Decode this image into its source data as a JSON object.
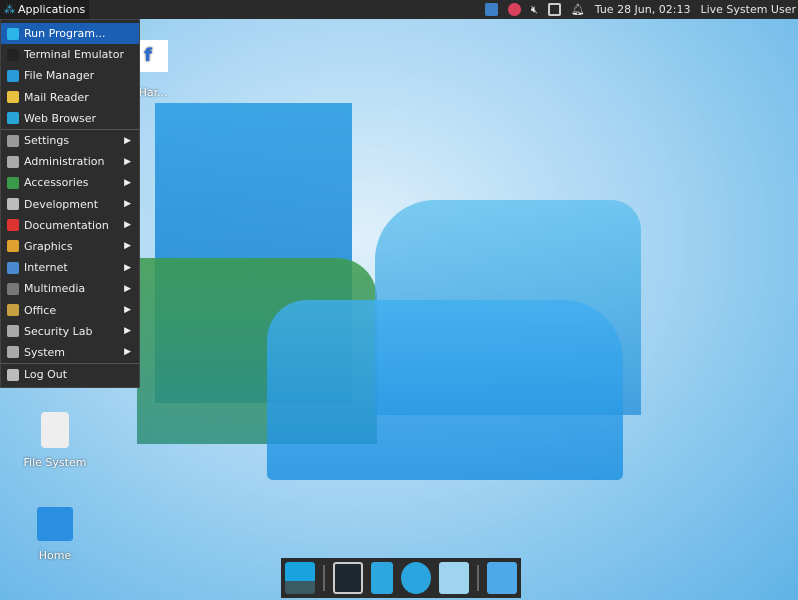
{
  "panel": {
    "applications": "Applications",
    "clock": "Tue 28 Jun, 02:13",
    "user": "Live System User"
  },
  "tray": [
    "network-icon",
    "software-update-icon",
    "volume-muted-icon",
    "clipboard-icon",
    "notifications-icon"
  ],
  "menu": [
    {
      "label": "Run Program...",
      "icon": "run-icon",
      "color": "#2cb5e8",
      "selected": true
    },
    {
      "label": "Terminal Emulator",
      "icon": "terminal-icon",
      "color": "#222"
    },
    {
      "label": "File Manager",
      "icon": "file-manager-icon",
      "color": "#2a9bd8"
    },
    {
      "label": "Mail Reader",
      "icon": "mail-icon",
      "color": "#e8c040"
    },
    {
      "label": "Web Browser",
      "icon": "web-browser-icon",
      "color": "#2aa5d8"
    },
    {
      "label": "Settings",
      "icon": "settings-icon",
      "color": "#999",
      "submenu": true
    },
    {
      "label": "Administration",
      "icon": "administration-icon",
      "color": "#aaa",
      "submenu": true
    },
    {
      "label": "Accessories",
      "icon": "accessories-icon",
      "color": "#3a9a4a",
      "submenu": true
    },
    {
      "label": "Development",
      "icon": "development-icon",
      "color": "#bbb",
      "submenu": true
    },
    {
      "label": "Documentation",
      "icon": "documentation-icon",
      "color": "#d33",
      "submenu": true
    },
    {
      "label": "Graphics",
      "icon": "graphics-icon",
      "color": "#e0a030",
      "submenu": true
    },
    {
      "label": "Internet",
      "icon": "internet-icon",
      "color": "#4a8ad0",
      "submenu": true
    },
    {
      "label": "Multimedia",
      "icon": "multimedia-icon",
      "color": "#777",
      "submenu": true
    },
    {
      "label": "Office",
      "icon": "office-icon",
      "color": "#c9a040",
      "submenu": true
    },
    {
      "label": "Security Lab",
      "icon": "security-lab-icon",
      "color": "#aaa",
      "submenu": true
    },
    {
      "label": "System",
      "icon": "system-icon",
      "color": "#aaa",
      "submenu": true
    },
    {
      "label": "Log Out",
      "icon": "log-out-icon",
      "color": "#bbb"
    }
  ],
  "desktop": {
    "install": "o Har...",
    "filesystem": "File System",
    "home": "Home"
  },
  "dock": [
    "show-desktop",
    "terminal",
    "file-manager",
    "web-browser",
    "app-finder",
    "home-folder"
  ]
}
